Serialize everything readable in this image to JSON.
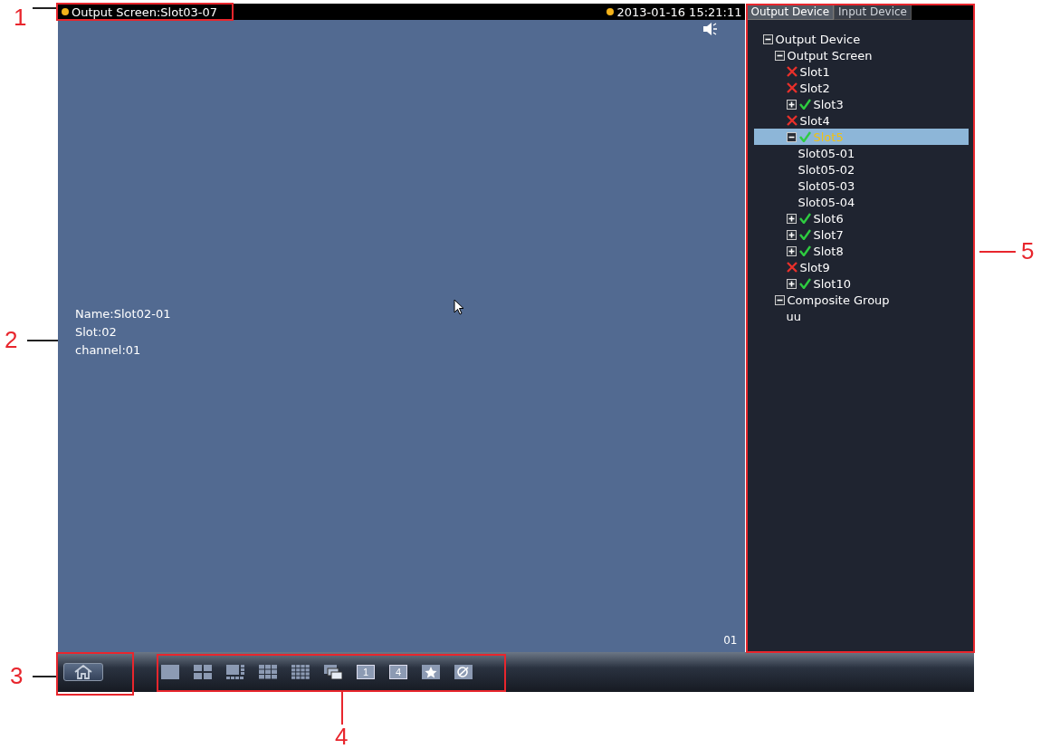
{
  "top_bar": {
    "screen_label": "Output Screen:Slot03-07",
    "datetime": "2013-01-16 15:21:11"
  },
  "video": {
    "info": [
      "Name:Slot02-01",
      "Slot:02",
      "channel:01"
    ],
    "channel_number": "01"
  },
  "tabs": [
    {
      "label": "Output Device",
      "selected": true
    },
    {
      "label": "Input Device",
      "selected": false
    }
  ],
  "tree": [
    {
      "label": "Output Device",
      "expanded": true,
      "selected": false,
      "children": [
        {
          "label": "Output Screen",
          "expanded": true,
          "selected": false,
          "children": [
            {
              "label": "Slot1",
              "connected": false,
              "selected": false
            },
            {
              "label": "Slot2",
              "connected": false,
              "selected": false
            },
            {
              "label": "Slot3",
              "connected": true,
              "expanded": false,
              "selected": false
            },
            {
              "label": "Slot4",
              "connected": false,
              "selected": false
            },
            {
              "label": "Slot5",
              "connected": true,
              "expanded": true,
              "selected": true,
              "children": [
                {
                  "label": "Slot05-01",
                  "selected": false
                },
                {
                  "label": "Slot05-02",
                  "selected": false
                },
                {
                  "label": "Slot05-03",
                  "selected": false
                },
                {
                  "label": "Slot05-04",
                  "selected": false
                }
              ]
            },
            {
              "label": "Slot6",
              "connected": true,
              "expanded": false,
              "selected": false
            },
            {
              "label": "Slot7",
              "connected": true,
              "expanded": false,
              "selected": false
            },
            {
              "label": "Slot8",
              "connected": true,
              "expanded": false,
              "selected": false
            },
            {
              "label": "Slot9",
              "connected": false,
              "selected": false
            },
            {
              "label": "Slot10",
              "connected": true,
              "expanded": false,
              "selected": false
            }
          ]
        },
        {
          "label": "Composite Group",
          "expanded": true,
          "selected": false,
          "children": [
            {
              "label": "uu",
              "selected": false
            }
          ]
        }
      ]
    }
  ],
  "toolbar": [
    {
      "kind": "single"
    },
    {
      "kind": "quad"
    },
    {
      "kind": "six"
    },
    {
      "kind": "nine"
    },
    {
      "kind": "sixteen"
    },
    {
      "kind": "pip"
    },
    {
      "kind": "number",
      "label": "1"
    },
    {
      "kind": "number",
      "label": "4"
    },
    {
      "kind": "favorite"
    },
    {
      "kind": "tour"
    }
  ],
  "callouts": [
    {
      "label": "1"
    },
    {
      "label": "2"
    },
    {
      "label": "3"
    },
    {
      "label": "4"
    },
    {
      "label": "5"
    }
  ]
}
